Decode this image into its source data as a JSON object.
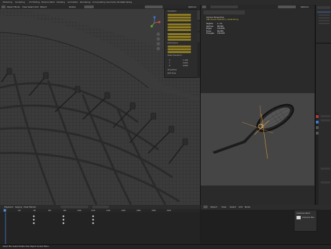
{
  "topbar": {
    "tabs": [
      "Modeling",
      "Sculpting",
      "UV Editing",
      "Texture Paint",
      "Shading",
      "Animation",
      "Rendering",
      "Compositing",
      "Geometry Nodes",
      "Scripting"
    ]
  },
  "left_viewport": {
    "mode": "Object Mode",
    "menu": [
      "View",
      "Select",
      "Add",
      "Object"
    ],
    "transform_pivot": "Global",
    "options_label": "Options"
  },
  "npanel": {
    "sections": [
      "Transform",
      "Dimensions",
      "Delta Transform",
      "Properties",
      "Edit Tools"
    ],
    "axes": [
      "X",
      "Y",
      "Z"
    ],
    "values": [
      "1.126",
      "0.000",
      "0.000"
    ],
    "tabs": [
      "Item",
      "Tool",
      "View"
    ]
  },
  "right_viewport": {
    "title": "Camera Perspective",
    "subtitle": "(38) Scene Collection | racket string",
    "stats": [
      {
        "label": "Objects",
        "value": "1 / 11"
      },
      {
        "label": "Vertices",
        "value": "68,584"
      },
      {
        "label": "Edges",
        "value": "139,836"
      },
      {
        "label": "Faces",
        "value": "68,956"
      },
      {
        "label": "Triangles",
        "value": "136,928"
      }
    ],
    "options_label": "Options"
  },
  "timeline": {
    "menu": [
      "Playback",
      "Keying",
      "View",
      "Marker"
    ],
    "current_frame": "1",
    "ticks": [
      "0",
      "20",
      "40",
      "60",
      "80",
      "100",
      "120",
      "140",
      "160",
      "180",
      "200",
      "220"
    ]
  },
  "bottom_right": {
    "menu": [
      "Object",
      "View",
      "Select",
      "Add",
      "Node"
    ],
    "popup_items": [
      "Camera Root",
      "Camera Pos"
    ]
  },
  "statusbar": {
    "text": "Select  Box Select  Rotate View  Object Context Menu"
  },
  "colors": {
    "accent": "#d9a424",
    "active_blue": "#3d6ea8"
  }
}
